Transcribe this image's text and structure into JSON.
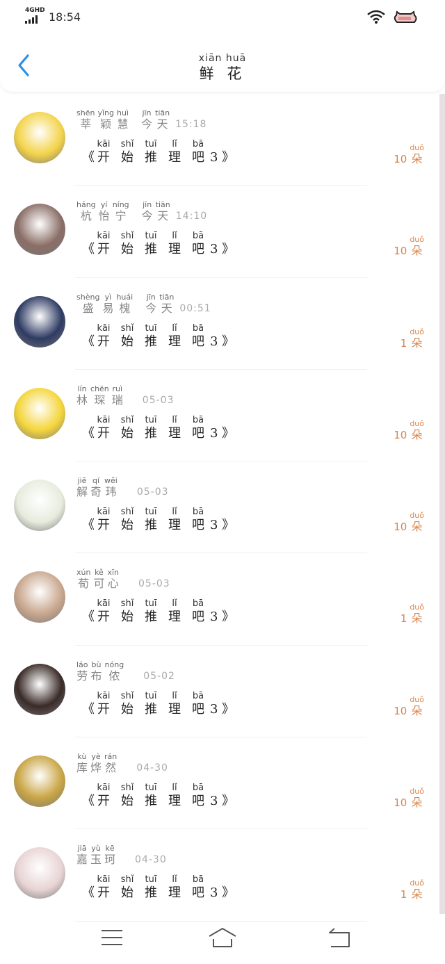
{
  "status_bar": {
    "network": "4GHD",
    "time": "18:54"
  },
  "header": {
    "title_pinyin": "xiān huā",
    "title": "鲜 花"
  },
  "message": {
    "open": "《",
    "close": "3 》",
    "words": [
      {
        "py": "kāi",
        "hz": "开"
      },
      {
        "py": "shǐ",
        "hz": "始"
      },
      {
        "py": "tuī",
        "hz": "推"
      },
      {
        "py": "lǐ",
        "hz": "理"
      },
      {
        "py": "bā",
        "hz": "吧"
      }
    ]
  },
  "unit": {
    "py": "duǒ",
    "hz": "朵"
  },
  "items": [
    {
      "name": [
        {
          "py": "shēn",
          "hz": "莘"
        },
        {
          "py": "yǐng",
          "hz": "颖"
        },
        {
          "py": "huì",
          "hz": "慧"
        }
      ],
      "time_words": [
        {
          "py": "jīn",
          "hz": "今"
        },
        {
          "py": "tiān",
          "hz": "天"
        }
      ],
      "time": "15:18",
      "count": "10",
      "avatar_color": "#f3d34a"
    },
    {
      "name": [
        {
          "py": "háng",
          "hz": "杭"
        },
        {
          "py": "yí",
          "hz": "怡"
        },
        {
          "py": "níng",
          "hz": "宁"
        }
      ],
      "time_words": [
        {
          "py": "jīn",
          "hz": "今"
        },
        {
          "py": "tiān",
          "hz": "天"
        }
      ],
      "time": "14:10",
      "count": "10",
      "avatar_color": "#8a6e66"
    },
    {
      "name": [
        {
          "py": "shèng",
          "hz": "盛"
        },
        {
          "py": "yì",
          "hz": "易"
        },
        {
          "py": "huái",
          "hz": "槐"
        }
      ],
      "time_words": [
        {
          "py": "jīn",
          "hz": "今"
        },
        {
          "py": "tiān",
          "hz": "天"
        }
      ],
      "time": "00:51",
      "count": "1",
      "avatar_color": "#2e3b63"
    },
    {
      "name": [
        {
          "py": "lín",
          "hz": "林"
        },
        {
          "py": "chēn",
          "hz": "琛"
        },
        {
          "py": "ruì",
          "hz": "瑞"
        }
      ],
      "time_words": [],
      "time": "05-03",
      "count": "10",
      "avatar_color": "#f4d53b"
    },
    {
      "name": [
        {
          "py": "jiě",
          "hz": "解"
        },
        {
          "py": "qí",
          "hz": "奇"
        },
        {
          "py": "wěi",
          "hz": "玮"
        }
      ],
      "time_words": [],
      "time": "05-03",
      "count": "10",
      "avatar_color": "#e7ecde"
    },
    {
      "name": [
        {
          "py": "xún",
          "hz": "荀"
        },
        {
          "py": "kě",
          "hz": "可"
        },
        {
          "py": "xīn",
          "hz": "心"
        }
      ],
      "time_words": [],
      "time": "05-03",
      "count": "1",
      "avatar_color": "#c9a78e"
    },
    {
      "name": [
        {
          "py": "láo",
          "hz": "劳"
        },
        {
          "py": "bù",
          "hz": "布"
        },
        {
          "py": "nóng",
          "hz": "侬"
        }
      ],
      "time_words": [],
      "time": "05-02",
      "count": "10",
      "avatar_color": "#3a2b28"
    },
    {
      "name": [
        {
          "py": "kù",
          "hz": "库"
        },
        {
          "py": "yè",
          "hz": "烨"
        },
        {
          "py": "rán",
          "hz": "然"
        }
      ],
      "time_words": [],
      "time": "04-30",
      "count": "10",
      "avatar_color": "#c9a545"
    },
    {
      "name": [
        {
          "py": "jiā",
          "hz": "嘉"
        },
        {
          "py": "yù",
          "hz": "玉"
        },
        {
          "py": "kē",
          "hz": "珂"
        }
      ],
      "time_words": [],
      "time": "04-30",
      "count": "1",
      "avatar_color": "#e8d4d4"
    }
  ]
}
